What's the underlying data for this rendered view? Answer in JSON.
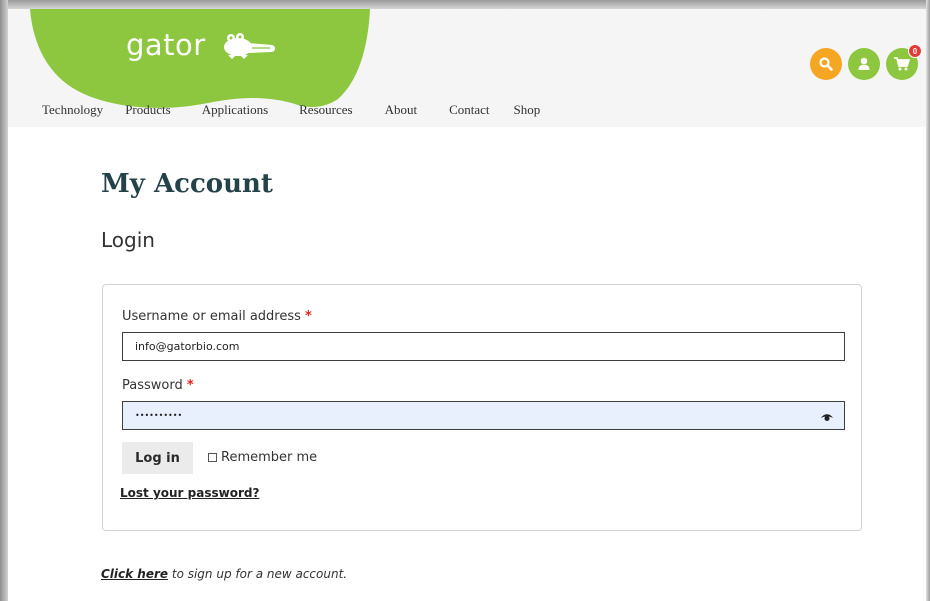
{
  "brand": {
    "logo_text": "gator",
    "accent_green": "#8dc63f",
    "search_orange": "#f5a623"
  },
  "nav": {
    "items": [
      "Technology",
      "Products",
      "Applications",
      "Resources",
      "About",
      "Contact",
      "Shop"
    ]
  },
  "header_icons": {
    "search": "search-icon",
    "account": "user-icon",
    "cart": "cart-icon",
    "cart_count": "0"
  },
  "page": {
    "title": "My Account",
    "subtitle": "Login"
  },
  "login_form": {
    "username_label": "Username or email address",
    "username_value": "info@gatorbio.com",
    "password_label": "Password",
    "password_value": "••••••••••",
    "required_mark": "*",
    "login_button": "Log in",
    "remember_label": "Remember me",
    "lost_password": "Lost your password?"
  },
  "signup": {
    "link_text": "Click here",
    "rest_text": " to sign up for a new account."
  }
}
